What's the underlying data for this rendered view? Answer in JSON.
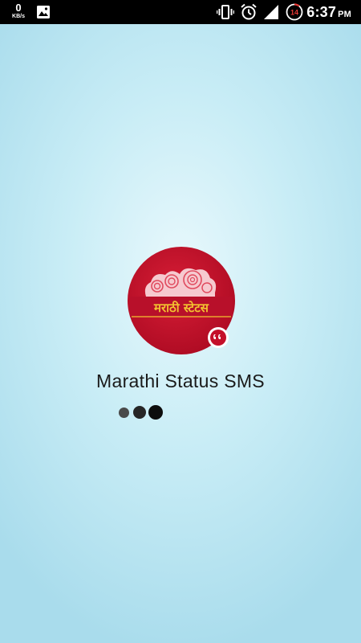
{
  "status_bar": {
    "network_speed_value": "0",
    "network_speed_unit": "KB/s",
    "battery_level": "14",
    "time": "6:37",
    "time_period": "PM"
  },
  "app": {
    "title": "Marathi Status SMS",
    "logo_text": "मराठी स्टेटस"
  },
  "colors": {
    "logo_red": "#c4102a",
    "banner_gold": "#f2c230"
  }
}
